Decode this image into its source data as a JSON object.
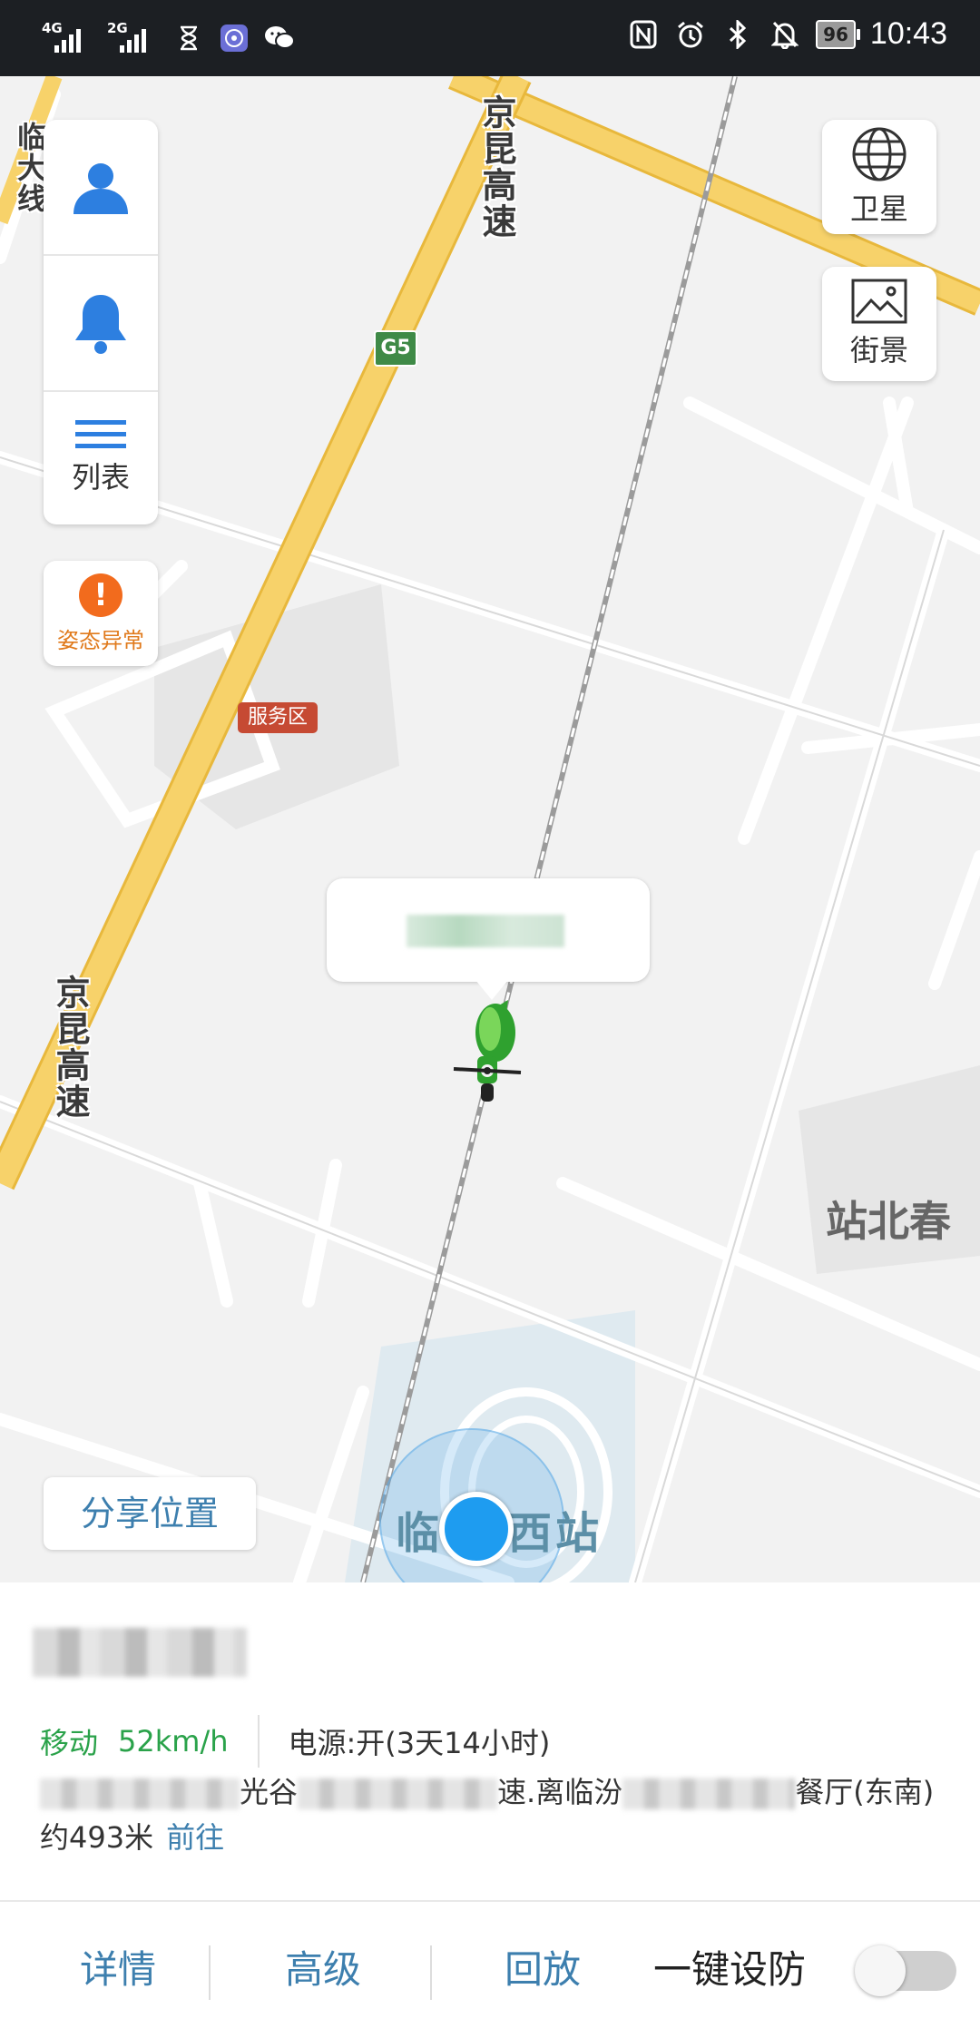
{
  "status_bar": {
    "signal_1": "4G",
    "signal_2": "2G",
    "battery": "96",
    "time": "10:43",
    "icons": [
      "hourglass-icon",
      "music-icon",
      "wechat-icon",
      "nfc-icon",
      "alarm-icon",
      "bluetooth-icon",
      "mute-icon"
    ]
  },
  "map": {
    "left_panel": {
      "profile_icon": "person-icon",
      "alert_icon": "bell-icon",
      "list_label": "列表"
    },
    "attitude_alert": {
      "badge": "!",
      "label": "姿态异常"
    },
    "satellite_label": "卫星",
    "street_view_label": "街景",
    "share_label": "分享位置",
    "labels": {
      "road_top_left": "临大线",
      "road_highway_top": "京昆高速",
      "road_highway_bottom": "京昆高速",
      "highway_shield": "G5",
      "service_area": "服务区",
      "town": "站北春",
      "station_left": "临",
      "station_right": "西站"
    }
  },
  "info": {
    "motion_state": "移动",
    "speed": "52km/h",
    "power": "电源:开(3天14小时)",
    "address_part_1": "光谷",
    "address_part_2": "速.离临汾",
    "address_part_3": "餐厅(东南)",
    "distance": "约493米",
    "goto_label": "前往"
  },
  "bottom_bar": {
    "details": "详情",
    "advanced": "高级",
    "playback": "回放",
    "arm_label": "一键设防",
    "arm_enabled": false
  },
  "colors": {
    "accent_blue": "#3d7fae",
    "moving_green": "#2aa24a",
    "highway_yellow": "#f7c948",
    "warning_orange": "#f26b1d",
    "icon_blue": "#2d7fe0"
  }
}
